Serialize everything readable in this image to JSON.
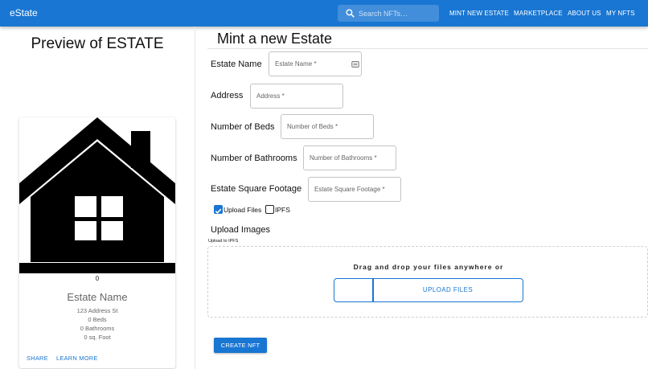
{
  "appbar": {
    "brand": "eState",
    "search_placeholder": "Search NFTs…",
    "nav": [
      "MINT NEW ESTATE",
      "MARKETPLACE",
      "ABOUT US",
      "MY NFTS"
    ]
  },
  "preview": {
    "title": "Preview of ESTATE",
    "card": {
      "image_icon": "house-icon",
      "token_id": "0",
      "name": "Estate Name",
      "address": "123 Address St",
      "beds": "0 Beds",
      "bathrooms": "0 Bathrooms",
      "sqft": "0 sq. Foot",
      "actions": {
        "share": "SHARE",
        "learn_more": "LEARN MORE"
      }
    }
  },
  "form": {
    "title": "Mint a new Estate",
    "fields": [
      {
        "label": "Estate Name",
        "placeholder": "Estate Name *"
      },
      {
        "label": "Address",
        "placeholder": "Address *"
      },
      {
        "label": "Number of Beds",
        "placeholder": "Number of Beds *"
      },
      {
        "label": "Number of Bathrooms",
        "placeholder": "Number of Bathrooms *"
      },
      {
        "label": "Estate Square Footage",
        "placeholder": "Estate Square Footage *"
      }
    ],
    "checkboxes": [
      {
        "label": "Upload Files",
        "checked": true
      },
      {
        "label": "IPFS",
        "checked": false
      }
    ],
    "upload": {
      "title": "Upload Images",
      "subtitle": "Upload to IPFS",
      "drop_text": "Drag and drop your files anywhere or",
      "button_label": "UPLOAD FILES"
    },
    "create_label": "CREATE NFT"
  },
  "colors": {
    "primary": "#1976d2"
  }
}
